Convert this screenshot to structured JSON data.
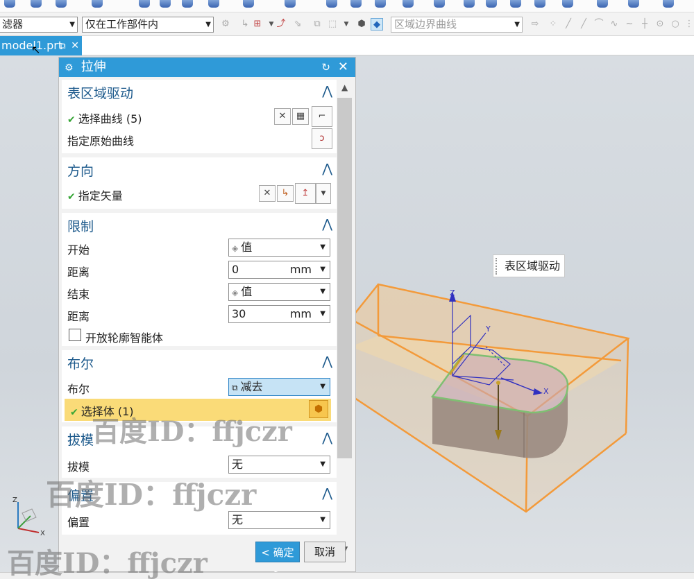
{
  "toolbar": {
    "filter_label": "滤器",
    "scope_value": "仅在工作部件内",
    "curve_rule_value": "区域边界曲线"
  },
  "file_tab": {
    "label": "model1.prt"
  },
  "dialog": {
    "title": "拉伸",
    "groups": {
      "section": {
        "title": "表区域驱动",
        "select_curve": "选择曲线 (5)",
        "specify_original": "指定原始曲线"
      },
      "direction": {
        "title": "方向",
        "specify_vector": "指定矢量"
      },
      "limits": {
        "title": "限制",
        "start_label": "开始",
        "start_value": "值",
        "start_distance_label": "距离",
        "start_distance": "0",
        "end_label": "结束",
        "end_value": "值",
        "end_distance_label": "距离",
        "end_distance": "30",
        "unit": "mm",
        "open_profile": "开放轮廓智能体"
      },
      "boolean": {
        "title": "布尔",
        "boolean_label": "布尔",
        "boolean_value": "减去",
        "select_body": "选择体 (1)"
      },
      "draft": {
        "title": "拔模",
        "draft_label": "拔模",
        "draft_value": "无"
      },
      "offset": {
        "title": "偏置",
        "offset_label": "偏置",
        "offset_value": "无"
      }
    },
    "ok_label": "< 确定 >",
    "cancel_label": "取消"
  },
  "viewport": {
    "tooltip": "表区域驱动",
    "axis_z": "Z",
    "axis_y": "Y",
    "axis_x": "X"
  },
  "watermark": "百度ID：ffjczr",
  "colors": {
    "accent": "#2f9ad8",
    "group_title": "#1d5a8c",
    "check": "#35a535",
    "highlight_row": "#fadb78",
    "body": "#f4cf9a"
  }
}
